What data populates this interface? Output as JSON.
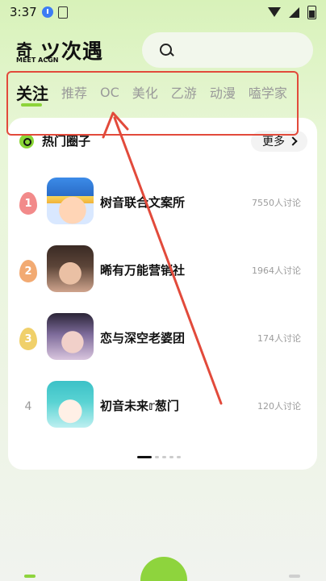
{
  "status_bar": {
    "time": "3:37",
    "icons": [
      "download-icon",
      "document-icon",
      "wifi-icon",
      "signal-icon",
      "battery-icon"
    ]
  },
  "header": {
    "logo_mark": "奇",
    "logo_text": "ツ次遇",
    "logo_sub": "MEET ACGN",
    "search_icon": "search-icon"
  },
  "tabs": [
    {
      "label": "关注",
      "active": true
    },
    {
      "label": "推荐"
    },
    {
      "label": "OC"
    },
    {
      "label": "美化"
    },
    {
      "label": "乙游"
    },
    {
      "label": "动漫"
    },
    {
      "label": "嗑学家"
    }
  ],
  "hot_circles": {
    "title": "热门圈子",
    "more_label": "更多",
    "items": [
      {
        "rank": "1",
        "name": "树音联合文案所",
        "count": "7550人讨论"
      },
      {
        "rank": "2",
        "name": "晞有万能营销社",
        "count": "1964人讨论"
      },
      {
        "rank": "3",
        "name": "恋与深空老婆团",
        "count": "174人讨论"
      },
      {
        "rank": "4",
        "name": "初音未来𝕣葱门",
        "count": "120人讨论"
      }
    ]
  },
  "colors": {
    "accent_green": "#8dd43a",
    "annotation_red": "#e24a3b"
  }
}
